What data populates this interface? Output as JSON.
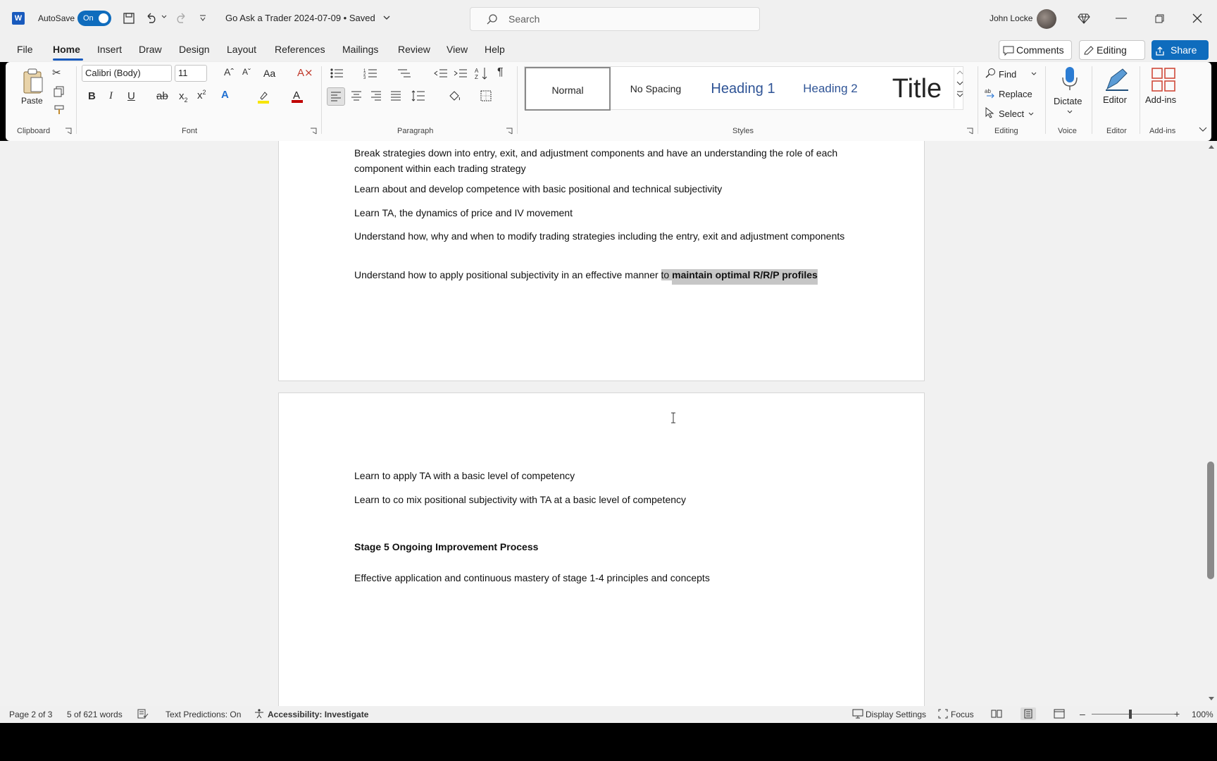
{
  "titlebar": {
    "app_icon": "W",
    "autosave_label": "AutoSave",
    "autosave_state": "On",
    "document_title": "Go Ask a Trader 2024-07-09 • Saved",
    "search_placeholder": "Search",
    "user_name": "John Locke"
  },
  "menu": {
    "tabs": [
      "File",
      "Home",
      "Insert",
      "Draw",
      "Design",
      "Layout",
      "References",
      "Mailings",
      "Review",
      "View",
      "Help"
    ],
    "active_tab": "Home",
    "comments_label": "Comments",
    "editing_label": "Editing",
    "share_label": "Share"
  },
  "ribbon": {
    "clipboard": {
      "paste_label": "Paste",
      "group_label": "Clipboard"
    },
    "font": {
      "font_name": "Calibri (Body)",
      "font_size": "11",
      "group_label": "Font",
      "case_label": "Aa"
    },
    "paragraph": {
      "group_label": "Paragraph"
    },
    "styles": {
      "items": [
        "Normal",
        "No Spacing",
        "Heading 1",
        "Heading 2",
        "Title"
      ],
      "group_label": "Styles"
    },
    "editing": {
      "find_label": "Find",
      "replace_label": "Replace",
      "select_label": "Select",
      "group_label": "Editing"
    },
    "voice": {
      "dictate_label": "Dictate",
      "group_label": "Voice"
    },
    "editor": {
      "editor_label": "Editor",
      "group_label": "Editor"
    },
    "addins": {
      "addins_label": "Add-ins",
      "group_label": "Add-ins"
    }
  },
  "document": {
    "page1_paragraphs": [
      "Break strategies down into entry, exit, and adjustment components and have an understanding the role of each component within each trading strategy",
      "Learn about and develop competence with basic positional and technical subjectivity",
      "Learn TA, the dynamics of price and IV movement",
      "Understand how, why and when to modify trading strategies including the entry, exit and adjustment components"
    ],
    "last_para_prefix": "Understand how to apply positional subjectivity in an effective manner ",
    "last_para_selected_plain": "to ",
    "last_para_selected_bold": "maintain optimal R/R/P profiles",
    "page2_paragraphs": [
      "Learn to apply TA with a basic level of competency",
      "Learn to co mix positional subjectivity with TA at a basic level of competency"
    ],
    "stage_heading": "Stage 5 Ongoing Improvement Process",
    "stage_paragraph": "Effective application and continuous mastery of stage 1-4 principles and concepts"
  },
  "statusbar": {
    "page_info": "Page 2 of 3",
    "word_count": "5 of 621 words",
    "text_predictions": "Text Predictions: On",
    "accessibility": "Accessibility: Investigate",
    "display_settings": "Display Settings",
    "focus": "Focus",
    "zoom": "100%"
  },
  "colors": {
    "accent": "#185abd",
    "share": "#0f6cbd",
    "selection": "#c6c6c6"
  }
}
